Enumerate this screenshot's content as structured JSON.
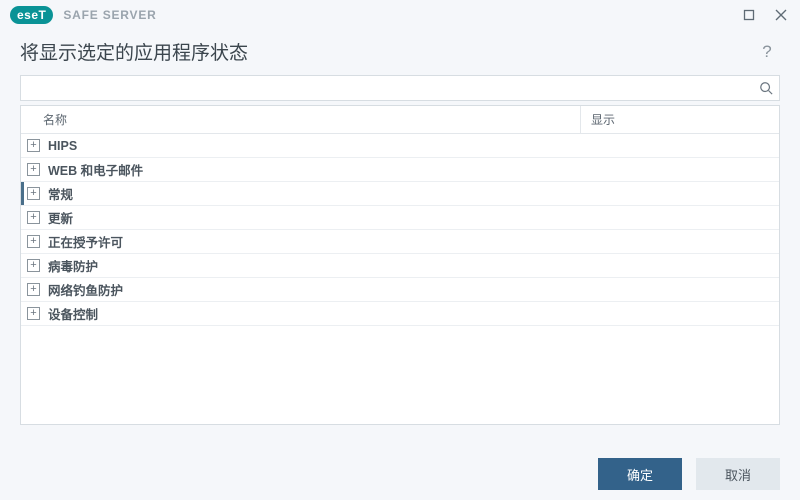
{
  "titlebar": {
    "brand_badge": "eseT",
    "brand_text": "SAFE SERVER"
  },
  "heading": {
    "title": "将显示选定的应用程序状态",
    "help_label": "?"
  },
  "search": {
    "placeholder": ""
  },
  "table": {
    "headers": {
      "name": "名称",
      "show": "显示"
    },
    "rows": [
      {
        "label": "HIPS",
        "selected": false
      },
      {
        "label": "WEB 和电子邮件",
        "selected": false
      },
      {
        "label": "常规",
        "selected": true
      },
      {
        "label": "更新",
        "selected": false
      },
      {
        "label": "正在授予许可",
        "selected": false
      },
      {
        "label": "病毒防护",
        "selected": false
      },
      {
        "label": "网络钓鱼防护",
        "selected": false
      },
      {
        "label": "设备控制",
        "selected": false
      }
    ]
  },
  "footer": {
    "ok": "确定",
    "cancel": "取消"
  }
}
